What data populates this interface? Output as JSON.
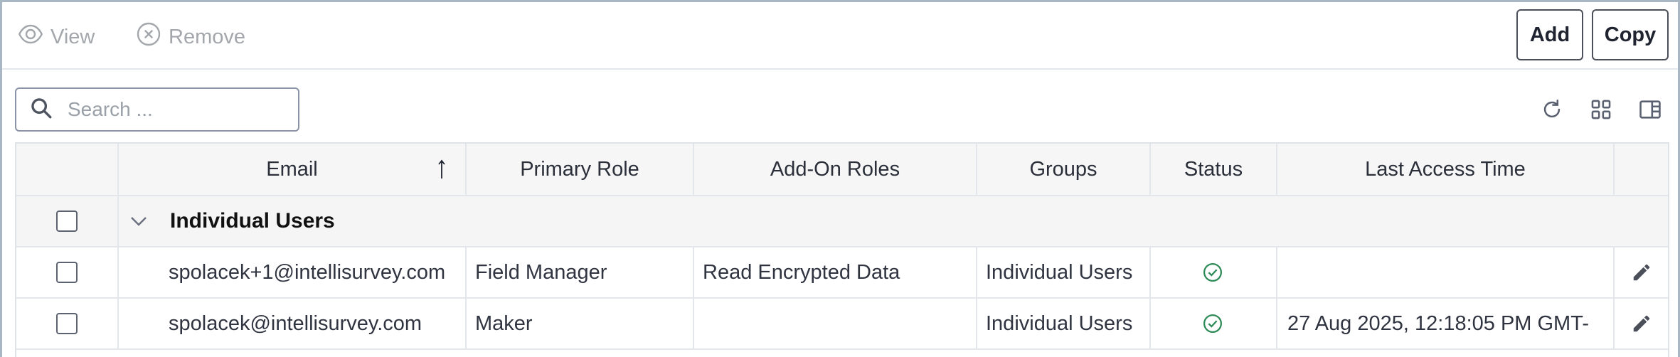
{
  "toolbar": {
    "view_label": "View",
    "remove_label": "Remove",
    "add_label": "Add",
    "copy_label": "Copy"
  },
  "search": {
    "placeholder": "Search ..."
  },
  "utility_icons": [
    "refresh-icon",
    "grid-view-icon",
    "column-panel-icon"
  ],
  "table": {
    "columns": [
      "Email",
      "Primary Role",
      "Add-On Roles",
      "Groups",
      "Status",
      "Last Access Time"
    ],
    "sort_column": "Email",
    "sort_direction": "ascending",
    "group": {
      "label": "Individual Users",
      "expanded": true
    },
    "rows": [
      {
        "email": "spolacek+1@intellisurvey.com",
        "primary_role": "Field Manager",
        "addon_roles": "Read Encrypted Data",
        "groups": "Individual Users",
        "status": "active",
        "last_access": ""
      },
      {
        "email": "spolacek@intellisurvey.com",
        "primary_role": "Maker",
        "addon_roles": "",
        "groups": "Individual Users",
        "status": "active",
        "last_access": "27 Aug 2025, 12:18:05 PM GMT-"
      }
    ]
  },
  "colors": {
    "status_active": "#2e8b57",
    "muted": "#a3a6ab",
    "border": "#e3e6ea"
  }
}
